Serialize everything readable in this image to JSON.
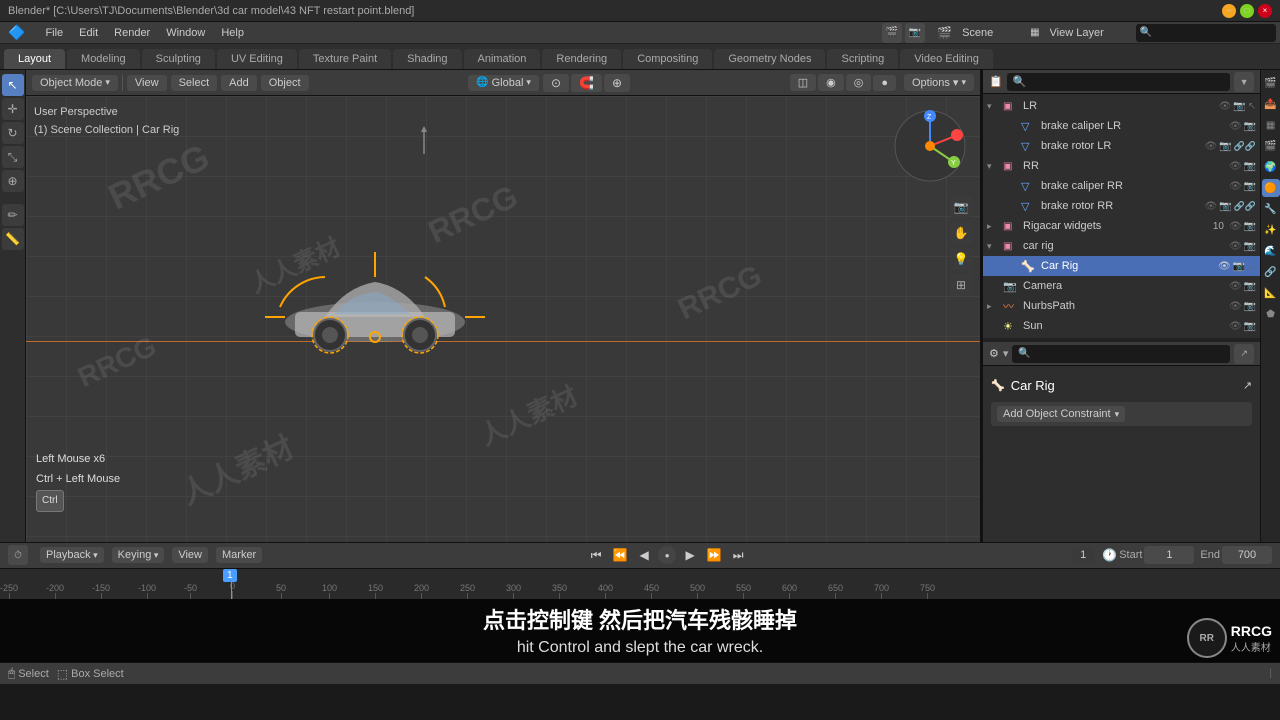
{
  "titlebar": {
    "title": "Blender* [C:\\Users\\TJ\\Documents\\Blender\\3d car model\\43 NFT restart point.blend]",
    "minimize": "−",
    "maximize": "□",
    "close": "×"
  },
  "menubar": {
    "items": [
      "File",
      "Edit",
      "Render",
      "Window",
      "Help"
    ]
  },
  "workspace_tabs": {
    "tabs": [
      "Layout",
      "Modeling",
      "Sculpting",
      "UV Editing",
      "Texture Paint",
      "Shading",
      "Animation",
      "Rendering",
      "Compositing",
      "Geometry Nodes",
      "Scripting",
      "Video Editing"
    ]
  },
  "viewport_header": {
    "mode": "Object Mode",
    "view_label": "View",
    "select_label": "Select",
    "add_label": "Add",
    "object_label": "Object",
    "global_label": "Global",
    "options_label": "Options ▾"
  },
  "viewport": {
    "perspective": "User Perspective",
    "collection": "(1) Scene Collection | Car Rig",
    "key_inputs": [
      "Left Mouse x6",
      "Ctrl + Left Mouse"
    ],
    "key_badge": "Ctrl"
  },
  "outliner": {
    "scene_label": "Scene",
    "view_layer": "View Layer",
    "items": [
      {
        "id": "lr",
        "label": "LR",
        "icon": "▸",
        "indent": 0,
        "type": "collection",
        "expanded": true
      },
      {
        "id": "brake-caliper-lr",
        "label": "brake caliper LR",
        "icon": "🔧",
        "indent": 1,
        "type": "mesh"
      },
      {
        "id": "brake-rotor-lr",
        "label": "brake rotor LR",
        "icon": "🔧",
        "indent": 1,
        "type": "mesh"
      },
      {
        "id": "rr",
        "label": "RR",
        "icon": "▸",
        "indent": 0,
        "type": "collection",
        "expanded": true
      },
      {
        "id": "brake-caliper-rr",
        "label": "brake caliper RR",
        "icon": "🔧",
        "indent": 1,
        "type": "mesh"
      },
      {
        "id": "brake-rotor-rr",
        "label": "brake rotor RR",
        "icon": "🔧",
        "indent": 1,
        "type": "mesh"
      },
      {
        "id": "rigacar-widgets",
        "label": "Rigacar widgets",
        "icon": "▸",
        "indent": 0,
        "type": "collection"
      },
      {
        "id": "car-rig-parent",
        "label": "car rig",
        "icon": "▾",
        "indent": 0,
        "type": "collection",
        "expanded": true
      },
      {
        "id": "car-rig",
        "label": "Car Rig",
        "icon": "🦴",
        "indent": 1,
        "type": "armature",
        "selected": true,
        "active": true
      },
      {
        "id": "camera",
        "label": "Camera",
        "icon": "📷",
        "indent": 0,
        "type": "camera"
      },
      {
        "id": "nurbspath",
        "label": "NurbsPath",
        "icon": "〰",
        "indent": 0,
        "type": "curve"
      },
      {
        "id": "sun",
        "label": "Sun",
        "icon": "☀",
        "indent": 0,
        "type": "light"
      }
    ]
  },
  "properties": {
    "object_label": "Car Rig",
    "constraint_label": "Add Object Constraint",
    "constraint_dropdown": "Add Object Constraint"
  },
  "timeline": {
    "playback_label": "Playback",
    "keying_label": "Keying",
    "view_label": "View",
    "marker_label": "Marker",
    "current_frame": "1",
    "start_label": "Start",
    "start_val": "1",
    "end_label": "End",
    "end_val": "700",
    "ticks": [
      "-250",
      "-200",
      "-150",
      "-100",
      "-50",
      "0",
      "50",
      "100",
      "150",
      "200",
      "250",
      "300",
      "350",
      "400",
      "450",
      "500",
      "550",
      "600",
      "650",
      "700",
      "750"
    ]
  },
  "subtitles": {
    "chinese": "点击控制键 然后把汽车残骸睡掉",
    "english": "hit Control and slept the car wreck."
  },
  "statusbar": {
    "select_label": "Select",
    "box_select_label": "Box Select"
  },
  "props_tabs": [
    "🎬",
    "▦",
    "🔵",
    "⬟",
    "〽",
    "🔗",
    "🧲",
    "⚙",
    "🌊",
    "📐"
  ],
  "watermarks": [
    "RRCG",
    "人人素材"
  ]
}
